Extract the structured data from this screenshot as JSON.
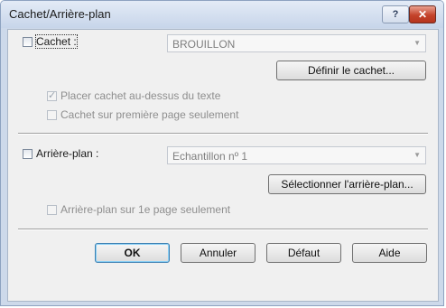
{
  "window": {
    "title": "Cachet/Arrière-plan",
    "help_label": "?",
    "close_label": "✕"
  },
  "stamp": {
    "checkbox_label": "Cachet :",
    "combo_value": "BROUILLON",
    "define_button": "Définir le cachet...",
    "option_over_text": {
      "label": "Placer cachet au-dessus du texte",
      "checked": true
    },
    "option_first_page": {
      "label": "Cachet sur première page seulement",
      "checked": false
    }
  },
  "background": {
    "checkbox_label": "Arrière-plan :",
    "combo_value": "Echantillon nº 1",
    "select_button": "Sélectionner l'arrière-plan...",
    "option_first_page": {
      "label": "Arrière-plan sur 1e page seulement",
      "checked": false
    }
  },
  "buttons": {
    "ok": "OK",
    "cancel": "Annuler",
    "default": "Défaut",
    "help": "Aide"
  }
}
